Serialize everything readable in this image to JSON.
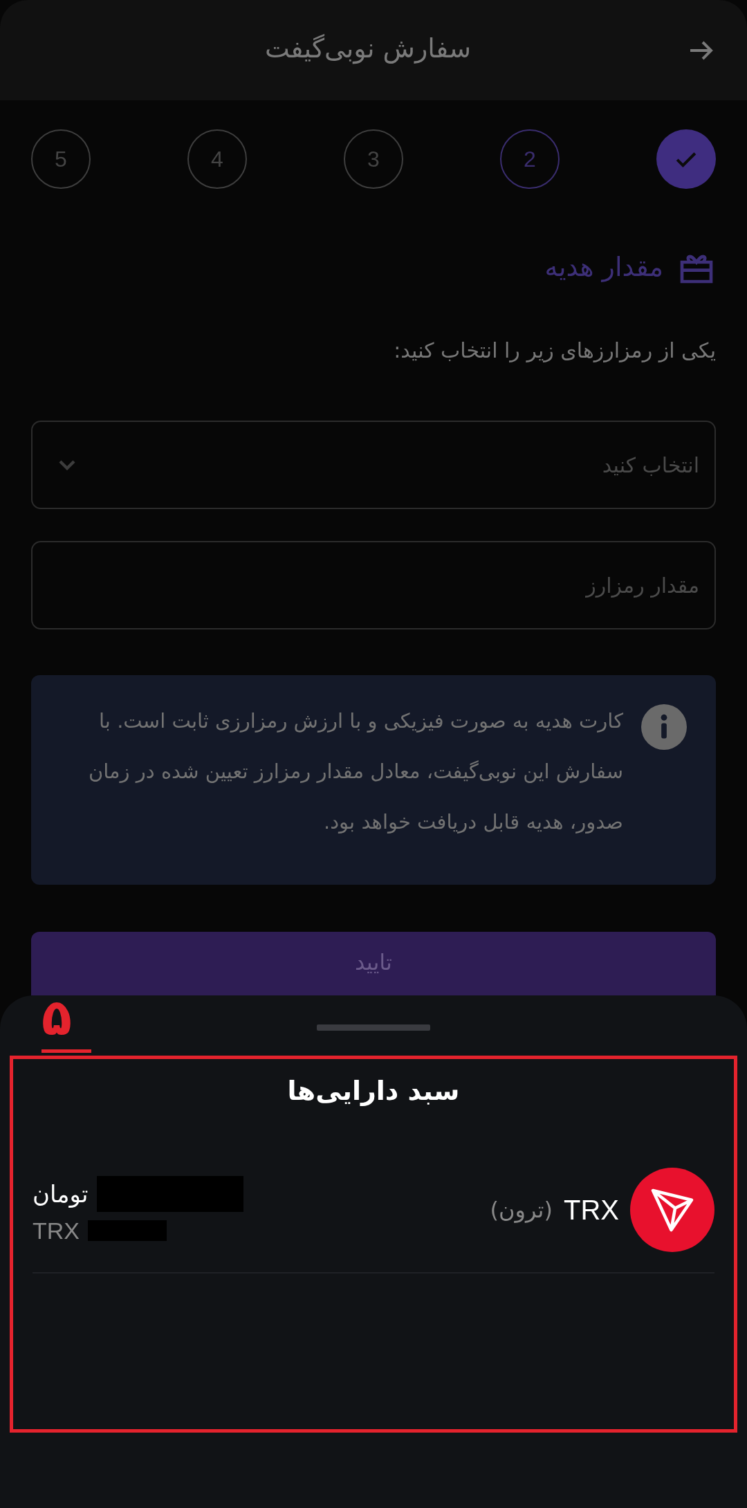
{
  "header": {
    "title": "سفارش نوبی‌گیفت"
  },
  "steps": [
    {
      "done": true,
      "selected": false
    },
    {
      "label": "2",
      "done": false,
      "selected": true
    },
    {
      "label": "3",
      "done": false,
      "selected": false
    },
    {
      "label": "4",
      "done": false,
      "selected": false
    },
    {
      "label": "5",
      "done": false,
      "selected": false
    }
  ],
  "section": {
    "title": "مقدار هدیه"
  },
  "instruction": "یکی از رمزارزهای زیر را انتخاب کنید:",
  "currency_select": {
    "placeholder": "انتخاب کنید"
  },
  "amount_field": {
    "placeholder": "مقدار رمزارز"
  },
  "info_note": "کارت هدیه به صورت فیزیکی و با ارزش رمزارزی ثابت است. با سفارش این نوبی‌گیفت، معادل مقدار رمزارز تعیین شده در زمان صدور، هدیه قابل دریافت خواهد بود.",
  "confirm_button": {
    "label": "تایید"
  },
  "sheet": {
    "title": "سبد دارایی‌ها",
    "assets": [
      {
        "symbol": "TRX",
        "name": "(ترون)",
        "fiat_unit": "تومان",
        "crypto_unit": "TRX"
      }
    ]
  },
  "annotation": {
    "marker": "۵"
  }
}
